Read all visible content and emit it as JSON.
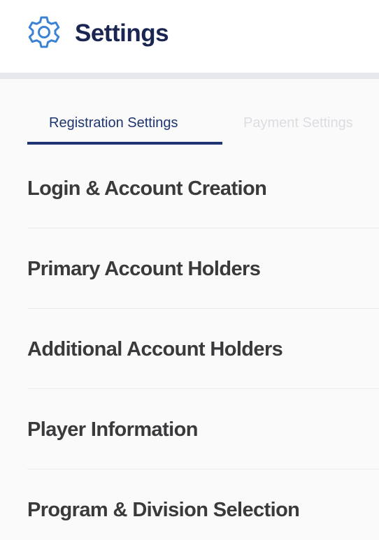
{
  "header": {
    "icon": "gear-icon",
    "title": "Settings"
  },
  "tabs": [
    {
      "label": "Registration Settings",
      "active": true
    },
    {
      "label": "Payment Settings",
      "active": false
    }
  ],
  "sections": [
    {
      "label": "Login & Account Creation"
    },
    {
      "label": "Primary Account Holders"
    },
    {
      "label": "Additional Account Holders"
    },
    {
      "label": "Player Information"
    },
    {
      "label": "Program & Division Selection"
    }
  ],
  "colors": {
    "title": "#1a2552",
    "accent": "#1f3572",
    "icon": "#3b82d6",
    "section_text": "#3a3a3c",
    "inactive_tab": "#dcdde2"
  }
}
